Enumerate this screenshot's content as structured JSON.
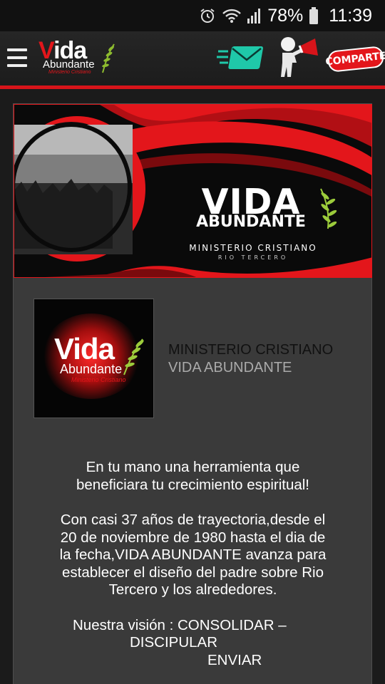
{
  "status_bar": {
    "battery": "78%",
    "time": "11:39",
    "icons": [
      "alarm-icon",
      "wifi-icon",
      "signal-icon",
      "battery-icon"
    ]
  },
  "header": {
    "logo": {
      "line1_v": "V",
      "line1_rest": "ida",
      "line2": "Abundante",
      "line3": "Ministerio Cristiano"
    },
    "share_label": "COMPARTE",
    "icons": [
      "menu-icon",
      "mail-icon",
      "megaphone-person-icon"
    ]
  },
  "banner": {
    "title": "VIDA",
    "subtitle": "ABUNDANTE",
    "line1": "MINISTERIO CRISTIANO",
    "line2": "RIO TERCERO"
  },
  "logo_card": {
    "line1": "Vida",
    "line2": "Abundante",
    "line3": "Ministerio Cristiano"
  },
  "org": {
    "line1": "MINISTERIO CRISTIANO",
    "line2": "VIDA ABUNDANTE"
  },
  "body": {
    "p1": [
      "En tu mano una herramienta que",
      "beneficiara tu crecimiento espiritual!"
    ],
    "p2": [
      "Con casi 37 años de trayectoria,desde el",
      "20 de noviembre de 1980 hasta el dia de",
      "la fecha,VIDA ABUNDANTE avanza para",
      "establecer el diseño del padre sobre Rio",
      "Tercero y los alrededores."
    ],
    "vision_a": "Nuestra visión :  CONSOLIDAR –",
    "vision_b": "DISCIPULAR",
    "vision_c": "ENVIAR"
  },
  "colors": {
    "accent": "#e3161b",
    "mail": "#1fc8a9",
    "background": "#3a3a3a"
  }
}
